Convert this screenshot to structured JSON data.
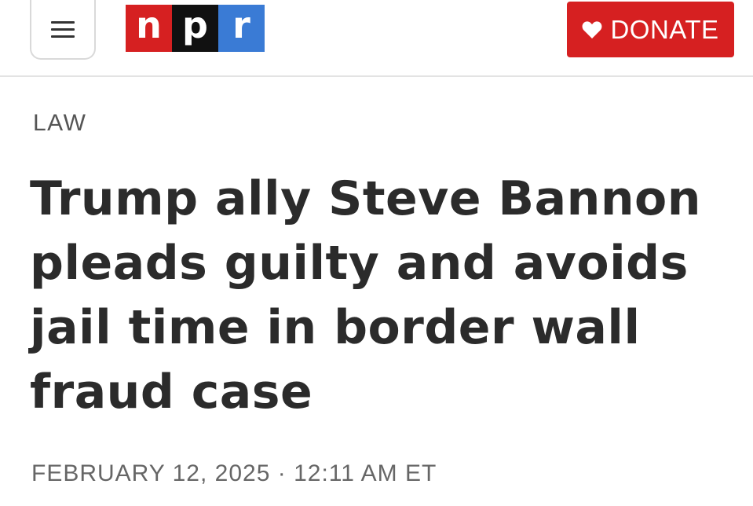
{
  "header": {
    "menu_icon": "hamburger-menu-icon",
    "logo": {
      "letters": [
        "n",
        "p",
        "r"
      ],
      "colors": [
        "#d62021",
        "#111111",
        "#3a7bd5"
      ]
    },
    "donate": {
      "label": "DONATE",
      "icon": "heart-icon",
      "color": "#d62021"
    }
  },
  "article": {
    "section": "LAW",
    "headline": "Trump ally Steve Bannon pleads guilty and avoids jail time in border wall fraud case",
    "date": "FEBRUARY 12, 2025",
    "separator": "·",
    "time": "12:11 AM ET"
  }
}
